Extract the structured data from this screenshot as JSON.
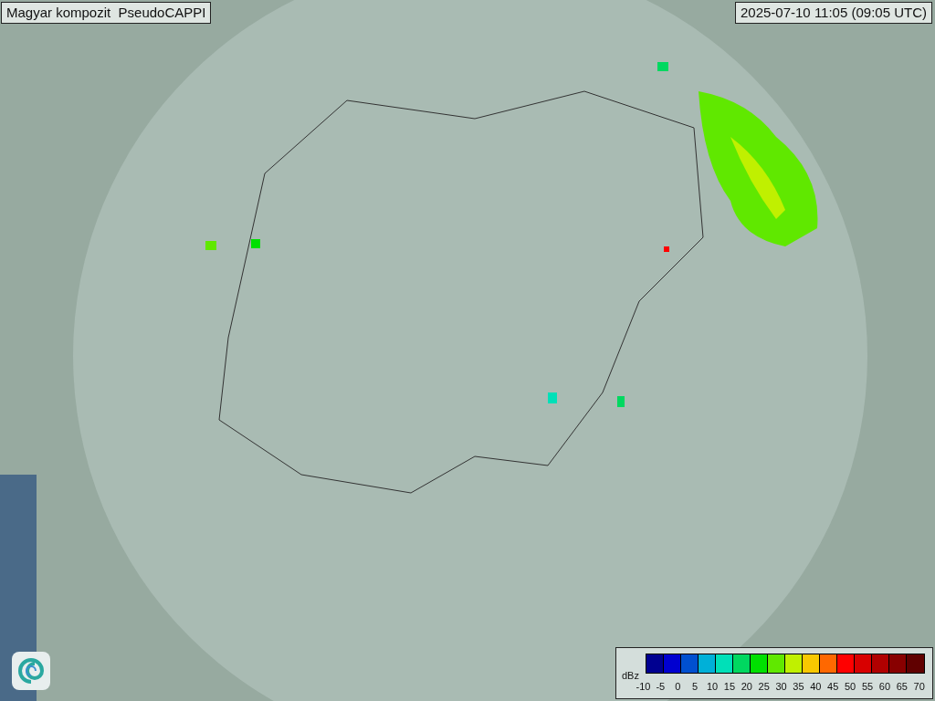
{
  "title": "Magyar kompozit  PseudoCAPPI",
  "timestamp": "2025-07-10 11:05 (09:05 UTC)",
  "legend": {
    "unit": "dBz",
    "bins": [
      {
        "color": "#000090"
      },
      {
        "color": "#0000d0"
      },
      {
        "color": "#0050d0"
      },
      {
        "color": "#00b0d8"
      },
      {
        "color": "#00e0b8"
      },
      {
        "color": "#00d860"
      },
      {
        "color": "#00e000"
      },
      {
        "color": "#60e800"
      },
      {
        "color": "#c0f000"
      },
      {
        "color": "#f8c800"
      },
      {
        "color": "#ff6800"
      },
      {
        "color": "#ff0000"
      },
      {
        "color": "#d80000"
      },
      {
        "color": "#b00000"
      },
      {
        "color": "#880000"
      },
      {
        "color": "#600000"
      }
    ],
    "ticks": [
      "-10",
      "-5",
      "0",
      "5",
      "10",
      "15",
      "20",
      "25",
      "30",
      "35",
      "40",
      "45",
      "50",
      "55",
      "60",
      "65",
      "70"
    ]
  }
}
